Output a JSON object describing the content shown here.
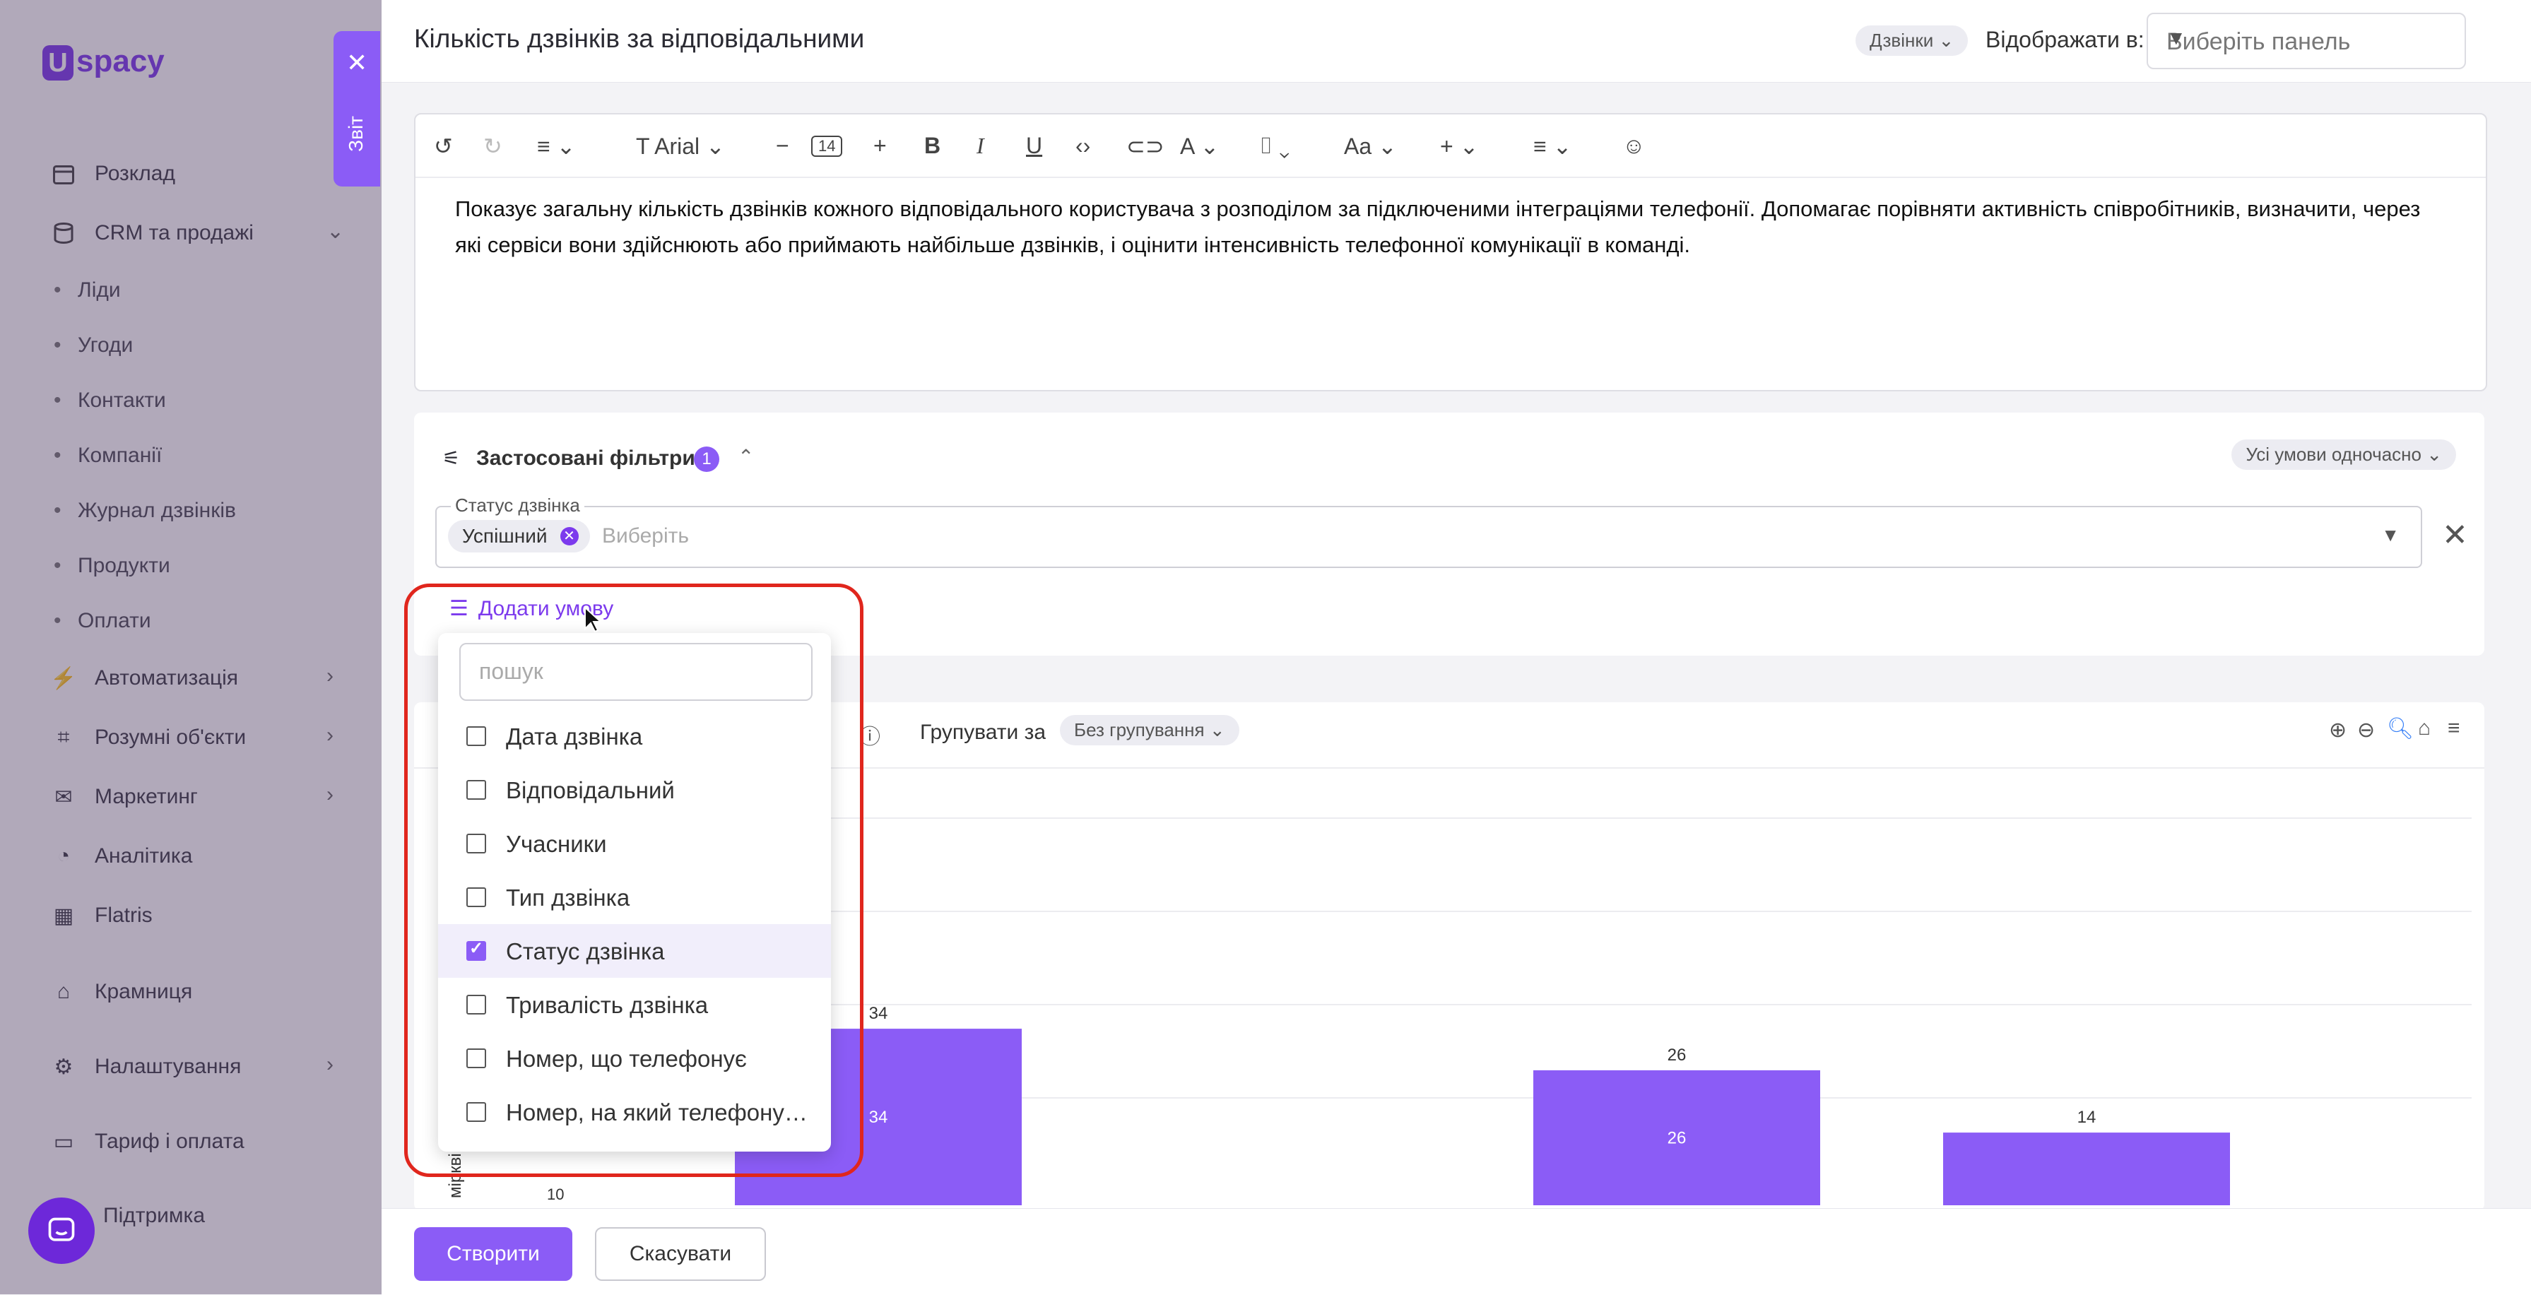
{
  "sidebar": {
    "logo": "U",
    "logo_text": "spacy",
    "items": [
      {
        "label": "Розклад"
      },
      {
        "label": "CRM та продажі"
      },
      {
        "label": "Ліди"
      },
      {
        "label": "Угоди"
      },
      {
        "label": "Контакти"
      },
      {
        "label": "Компанії"
      },
      {
        "label": "Журнал дзвінків"
      },
      {
        "label": "Продукти"
      },
      {
        "label": "Оплати"
      },
      {
        "label": "Автоматизація"
      },
      {
        "label": "Розумні об'єкти"
      },
      {
        "label": "Маркетинг"
      },
      {
        "label": "Аналітика"
      },
      {
        "label": "Flatris"
      },
      {
        "label": "Крамниця"
      },
      {
        "label": "Налаштування"
      },
      {
        "label": "Тариф і оплата"
      },
      {
        "label": "Підтримка"
      }
    ]
  },
  "report_tab": {
    "label": "Звіт",
    "close": "✕"
  },
  "header": {
    "title": "Кількість дзвінків за відповідальними",
    "source_pill": "Дзвінки",
    "show_in_label": "Відображати в:",
    "panel_placeholder": "Виберіть панель"
  },
  "toolbar": {
    "font": "Arial",
    "font_size": "14",
    "case_btn": "Aa"
  },
  "editor": {
    "text": "Показує загальну кількість дзвінків кожного відповідального користувача з розподілом за підключеними інтеграціями телефонії. Допомагає порівняти активність співробітників, визначити, через які сервіси вони здійснюють або приймають найбільше дзвінків, і оцінити інтенсивність телефонної комунікації в команді."
  },
  "filters": {
    "title": "Застосовані фільтри",
    "count": "1",
    "mode": "Усі умови одночасно",
    "field_label": "Статус дзвінка",
    "chip": "Успішний",
    "placeholder": "Виберіть",
    "add_condition": "Додати умову"
  },
  "dropdown": {
    "search_placeholder": "пошук",
    "options": [
      {
        "label": "Дата дзвінка",
        "checked": false
      },
      {
        "label": "Відповідальний",
        "checked": false
      },
      {
        "label": "Учасники",
        "checked": false
      },
      {
        "label": "Тип дзвінка",
        "checked": false
      },
      {
        "label": "Статус дзвінка",
        "checked": true
      },
      {
        "label": "Тривалість дзвінка",
        "checked": false
      },
      {
        "label": "Номер, що телефонує",
        "checked": false
      },
      {
        "label": "Номер, на який телефону…",
        "checked": false
      }
    ]
  },
  "chart_controls": {
    "group_by_label": "Групувати за",
    "group_by_value": "Без групування"
  },
  "chart_data": {
    "type": "bar",
    "ylabel": "міркві",
    "y_ticks_visible": [
      "10"
    ],
    "values": [
      34,
      26,
      14
    ],
    "top_labels": [
      "34",
      "26",
      "14"
    ],
    "inner_labels": [
      "34",
      "26"
    ],
    "color": "#8b5cf6"
  },
  "footer": {
    "create": "Створити",
    "cancel": "Скасувати"
  },
  "colors": {
    "accent": "#8b5cf6",
    "highlight": "#e0261d"
  }
}
